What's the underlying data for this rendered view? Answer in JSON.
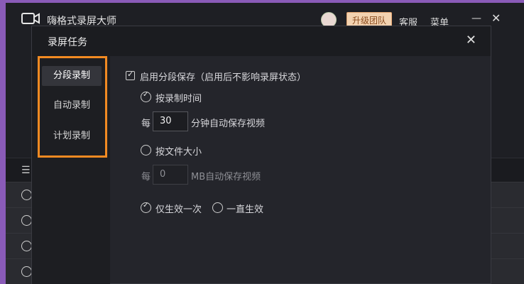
{
  "app": {
    "title": "嗨格式录屏大师",
    "upgrade_label": "升级团队",
    "service_label": "客服",
    "menu_label": "菜单",
    "minimize_glyph": "—",
    "close_glyph": "✕",
    "list_icon_glyph": "☰"
  },
  "dialog": {
    "title": "录屏任务",
    "close_glyph": "✕",
    "sidebar": {
      "items": [
        {
          "label": "分段录制"
        },
        {
          "label": "自动录制"
        },
        {
          "label": "计划录制"
        }
      ]
    },
    "segment": {
      "enable_label": "启用分段保存（启用后不影响录屏状态）",
      "by_time_label": "按录制时间",
      "every_label": "每",
      "time_value": "30",
      "time_suffix": "分钟自动保存视频",
      "by_size_label": "按文件大小",
      "size_every_label": "每",
      "size_value": "0",
      "size_suffix": "MB自动保存视频",
      "once_label": "仅生效一次",
      "always_label": "一直生效"
    }
  },
  "colors": {
    "highlight": "#f28a22",
    "background_accent": "#8a5bb8"
  }
}
